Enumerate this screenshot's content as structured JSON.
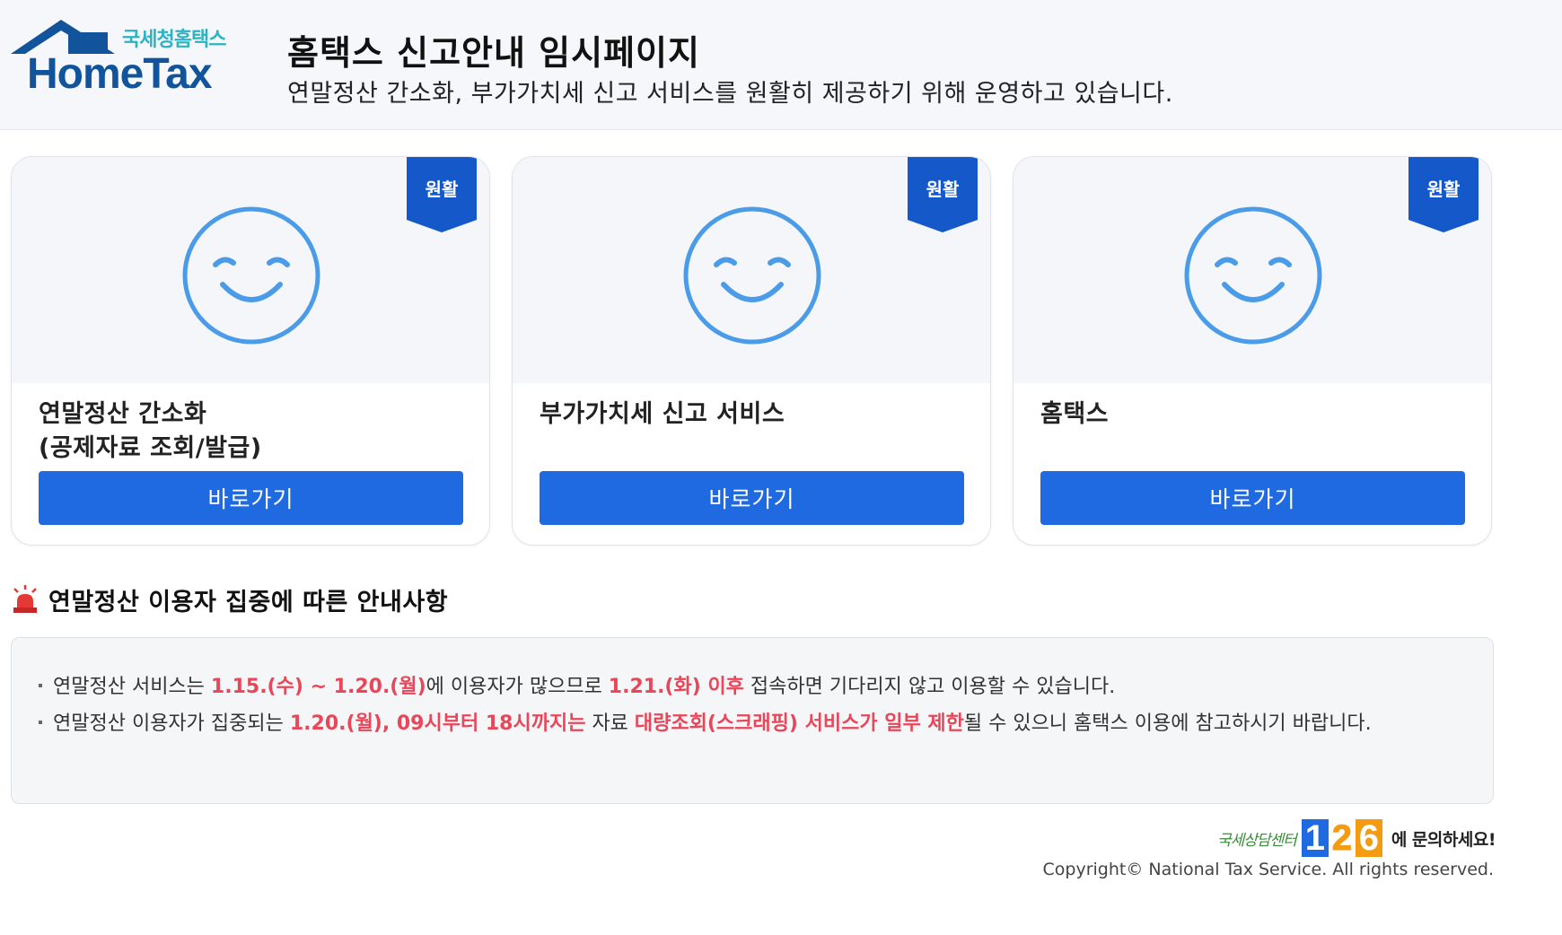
{
  "header": {
    "logo_sub": "국세청홈택스",
    "logo_main": "HomeTax",
    "title": "홈택스 신고안내 임시페이지",
    "description": "연말정산 간소화, 부가가치세 신고 서비스를 원활히 제공하기 위해 운영하고 있습니다."
  },
  "cards": [
    {
      "status": "원활",
      "title_line1": "연말정산 간소화",
      "title_line2": "(공제자료 조회/발급)",
      "button": "바로가기",
      "face_icon": "smile-icon"
    },
    {
      "status": "원활",
      "title_line1": "부가가치세 신고 서비스",
      "title_line2": "",
      "button": "바로가기",
      "face_icon": "smile-icon"
    },
    {
      "status": "원활",
      "title_line1": "홈택스",
      "title_line2": "",
      "button": "바로가기",
      "face_icon": "smile-icon"
    }
  ],
  "notice": {
    "title": "연말정산 이용자 집중에 따른 안내사항",
    "icon": "siren-icon",
    "items": [
      {
        "p1": "연말정산 서비스는 ",
        "h1": "1.15.(수) ~ 1.20.(월)",
        "p2": "에 이용자가 많으므로 ",
        "h2": "1.21.(화) 이후",
        "p3": " 접속하면 기다리지 않고 이용할 수 있습니다."
      },
      {
        "p1": "연말정산 이용자가 집중되는 ",
        "h1": "1.20.(월), 09시부터 18시까지는",
        "p2": " 자료 ",
        "h2": "대량조회(스크래핑) 서비스가 일부 제한",
        "p3": "될 수 있으니 홈택스 이용에 참고하시기 바랍니다."
      }
    ]
  },
  "footer": {
    "contact_prefix": "국세상담센터",
    "contact_d1": "1",
    "contact_d2": "2",
    "contact_d3": "6",
    "contact_suffix": "에 문의하세요!",
    "copyright": "Copyright© National Tax Service. All rights reserved."
  },
  "colors": {
    "accent": "#1f6ae0",
    "highlight": "#e8475a",
    "face": "#4a9be8",
    "logo_blue": "#12549b",
    "logo_teal": "#2cb3c4"
  }
}
